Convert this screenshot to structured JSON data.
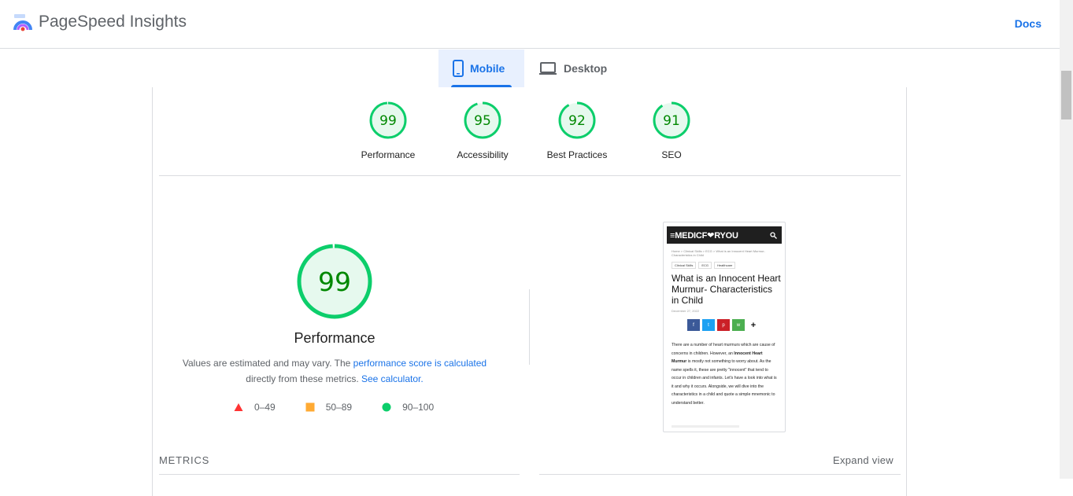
{
  "header": {
    "app_title": "PageSpeed Insights",
    "docs_label": "Docs",
    "logo_icon": "pagespeed-logo-icon"
  },
  "tabs": [
    {
      "label": "Mobile",
      "icon": "smartphone-icon",
      "active": true
    },
    {
      "label": "Desktop",
      "icon": "laptop-icon",
      "active": false
    }
  ],
  "scores": [
    {
      "value": "99",
      "label": "Performance",
      "score": 99
    },
    {
      "value": "95",
      "label": "Accessibility",
      "score": 95
    },
    {
      "value": "92",
      "label": "Best Practices",
      "score": 92
    },
    {
      "value": "91",
      "label": "SEO",
      "score": 91
    }
  ],
  "performance": {
    "value": "99",
    "score": 99,
    "title": "Performance",
    "desc_prefix": "Values are estimated and may vary. The ",
    "desc_link1": "performance score is calculated",
    "desc_middle": " directly from these metrics. ",
    "desc_link2": "See calculator.",
    "legend": [
      {
        "range": "0–49",
        "color": "#ff3333",
        "shape": "triangle"
      },
      {
        "range": "50–89",
        "color": "#ffaa33",
        "shape": "square"
      },
      {
        "range": "90–100",
        "color": "#0cce6b",
        "shape": "circle"
      }
    ]
  },
  "colors": {
    "pass": "#0cce6b",
    "pass_text": "#008800",
    "pass_bg": "#e6f9ee",
    "link": "#1a73e8"
  },
  "screenshot": {
    "brand": "≡MEDICF❤RYOU",
    "breadcrumb": "Home > Clinical Skills > ECG > What is an Innocent Heart Murmur- Characteristics in Child",
    "tags": [
      "Clinical Skills",
      "ECG",
      "Healthcare"
    ],
    "title": "What is an Innocent Heart Murmur- Characteristics in Child",
    "date": "December 27, 2022",
    "share": [
      {
        "label": "f",
        "color": "#3b5998"
      },
      {
        "label": "t",
        "color": "#1da1f2"
      },
      {
        "label": "p",
        "color": "#cb2027"
      },
      {
        "label": "w",
        "color": "#4caf50"
      },
      {
        "label": "+",
        "color": "#ffffff"
      }
    ],
    "body_1": "There are a number of heart murmurs which are cause of concerns in children. However, an ",
    "body_bold": "Innocent Heart Murmur",
    "body_2": " is mostly not something to worry about. As the name spells it, these are pretty \"innocent\" that tend to occur in children and infants. Let's have a look into what is it and why it occurs. Alongside, we will dive into the characteristics in a child and quote a simple mnemonic to understand better."
  },
  "footer": {
    "metrics_label": "METRICS",
    "expand_label": "Expand view"
  }
}
